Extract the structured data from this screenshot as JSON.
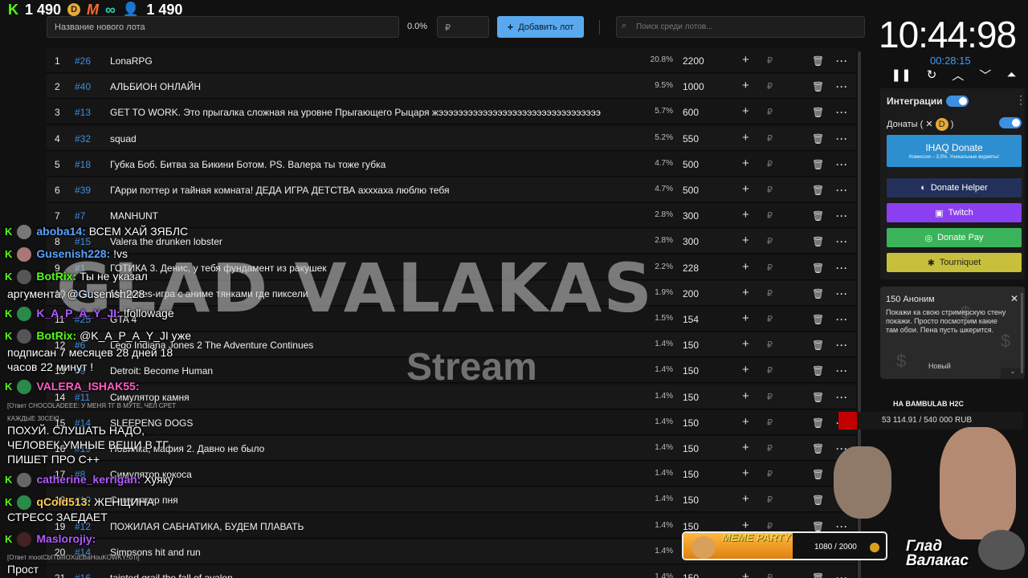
{
  "stats": {
    "kick_followers": "1 490",
    "viewers": "1 490"
  },
  "toolbar": {
    "lot_name_placeholder": "Название нового лота",
    "percent": "0.0%",
    "sum_placeholder": "₽",
    "add_label": "Добавить лот",
    "search_placeholder": "Поиск среди лотов..."
  },
  "lots": [
    {
      "num": "1",
      "id": "#26",
      "name": "LonaRPG",
      "pct": "20.8%",
      "sum": "2200"
    },
    {
      "num": "2",
      "id": "#40",
      "name": "АЛЬБИОН ОНЛАЙН",
      "pct": "9.5%",
      "sum": "1000"
    },
    {
      "num": "3",
      "id": "#13",
      "name": "GET TO WORK. Это прыгалка сложная на уровне Прыгающего Рыцаря жэээээээээээээээээээээээээээээээээ",
      "pct": "5.7%",
      "sum": "600"
    },
    {
      "num": "4",
      "id": "#32",
      "name": "squad",
      "pct": "5.2%",
      "sum": "550"
    },
    {
      "num": "5",
      "id": "#18",
      "name": "Губка Боб. Битва за Бикини Ботом. PS. Валера ты тоже губка",
      "pct": "4.7%",
      "sum": "500"
    },
    {
      "num": "6",
      "id": "#39",
      "name": "ГАрри поттер и тайная комната! ДЕДА ИГРА ДЕТСТВА ахххаха люблю тебя",
      "pct": "4.7%",
      "sum": "500"
    },
    {
      "num": "7",
      "id": "#7",
      "name": "MANHUNT",
      "pct": "2.8%",
      "sum": "300"
    },
    {
      "num": "8",
      "id": "#15",
      "name": "Valera the drunken lobster",
      "pct": "2.8%",
      "sum": "300"
    },
    {
      "num": "9",
      "id": "#1",
      "name": "ГОТИКА 3. Денис, у тебя фундамент из ракушек",
      "pct": "2.2%",
      "sum": "228"
    },
    {
      "num": "10",
      "id": "#30",
      "name": "Memories-игра с аниме тянками где пиксели",
      "pct": "1.9%",
      "sum": "200"
    },
    {
      "num": "11",
      "id": "#25",
      "name": "GTA 4",
      "pct": "1.5%",
      "sum": "154"
    },
    {
      "num": "12",
      "id": "#6",
      "name": "Lego Indiana Jones 2 The Adventure Continues",
      "pct": "1.4%",
      "sum": "150"
    },
    {
      "num": "13",
      "id": "#9",
      "name": "Detroit: Become Human",
      "pct": "1.4%",
      "sum": "150"
    },
    {
      "num": "14",
      "id": "#11",
      "name": "Симулятор камня",
      "pct": "1.4%",
      "sum": "150"
    },
    {
      "num": "15",
      "id": "#14",
      "name": "SLEEPENG DOGS",
      "pct": "1.4%",
      "sum": "150"
    },
    {
      "num": "16",
      "id": "#19",
      "name": "Новинка, мафия 2. Давно не было",
      "pct": "1.4%",
      "sum": "150"
    },
    {
      "num": "17",
      "id": "#8",
      "name": "Симулятор кокоса",
      "pct": "1.4%",
      "sum": "150"
    },
    {
      "num": "18",
      "id": "#10",
      "name": "Симулятор пня",
      "pct": "1.4%",
      "sum": "150"
    },
    {
      "num": "19",
      "id": "#12",
      "name": "ПОЖИЛАЯ САБНАТИКА, БУДЕМ ПЛАВАТЬ",
      "pct": "1.4%",
      "sum": "150"
    },
    {
      "num": "20",
      "id": "#14",
      "name": "Simpsons hit and run",
      "pct": "1.4%",
      "sum": ""
    },
    {
      "num": "21",
      "id": "#16",
      "name": "tainted grail the fall of avalon",
      "pct": "1.4%",
      "sum": "150"
    }
  ],
  "chat": [
    {
      "user": "aboba14:",
      "text": "ВСЕМ ХАЙ ЗЯБЛС",
      "color": "#5aa0ff"
    },
    {
      "user": "Gusenish228:",
      "text": "!vs",
      "color": "#5aa0ff"
    },
    {
      "user": "BotRix:",
      "text": "Ты не указал",
      "color": "#53fc18"
    },
    {
      "user": "",
      "text": "аргумента, @Gusenish228",
      "color": "#ffffff"
    },
    {
      "user": "K_A_P_A_Y_JI:",
      "text": "!followage",
      "color": "#b05aff"
    },
    {
      "user": "BotRix:",
      "text": "@K_A_P_A_Y_JI уже",
      "color": "#53fc18"
    },
    {
      "user": "",
      "text": "подписан 7 месяцев 28 дней 18",
      "color": "#ffffff"
    },
    {
      "user": "",
      "text": "часов 22 минут !",
      "color": "#ffffff"
    },
    {
      "user": "VALERA_ISHAK55:",
      "text": "",
      "color": "#ff5ac8"
    },
    {
      "user": "",
      "text": "ПОХУЙ. СЛУШАТЬ НАДО,",
      "color": "#ffffff"
    },
    {
      "user": "",
      "text": "ЧЕЛОВЕК УМНЫЕ ВЕЩИ В ТГ",
      "color": "#ffffff"
    },
    {
      "user": "",
      "text": "ПИШЕТ ПРО С++",
      "color": "#ffffff"
    },
    {
      "user": "catherine_kerrigan:",
      "text": "Хуяку",
      "color": "#b05aff"
    },
    {
      "user": "qCold513:",
      "text": "ЖЕНЩИНА",
      "color": "#ffd050"
    },
    {
      "user": "",
      "text": "СТРЕСС ЗАЕДАЕТ",
      "color": "#ffffff"
    },
    {
      "user": "Maslorojiy:",
      "text": "",
      "color": "#b05aff"
    },
    {
      "user": "",
      "text": "Прост",
      "color": "#ffffff"
    }
  ],
  "chat_notes": [
    "[Ответ CHOCOLADEEE: У МЕНЯ ТГ В МУТЕ, ЧЕЛ СРЕТ",
    "КАЖДЫЕ 30СЕК]",
    "[Ответ mootCbITbIIIOXuEBaHouKOWKY..oTi]"
  ],
  "watermark": {
    "title": "GLAD VALAKAS",
    "subtitle": "Stream"
  },
  "timer": {
    "clock": "10:44:98",
    "elapsed": "00:28:15"
  },
  "integrations": {
    "title": "Интеграции",
    "donates_label": "Донаты (",
    "donates_close": ")",
    "ihaq_title": "IHAQ Donate",
    "ihaq_sub": "Комиссия – 3,5%. Уникальные виджеты!",
    "donate_helper": "Donate Helper",
    "twitch": "Twitch",
    "donate_pay": "Donate Pay",
    "tourniquet": "Tourniquet"
  },
  "donation": {
    "who": "150 Аноним",
    "text": "Покажи ка свою стримерскую стену покажи. Просто посмотрим какие там обои. Пена пусть шкерится.",
    "status": "Новый"
  },
  "goal": {
    "title": "НА BAMBULAB H2C",
    "progress": "53 114.91 / 540 000 RUB",
    "fraction": 0.098
  },
  "meme": {
    "label": "MEME PARTY",
    "count": "1080 / 2000",
    "fraction": 0.54
  },
  "signature": {
    "line1": "Глад",
    "line2": "Валакас"
  },
  "colors": {
    "accent": "#3d8fe0",
    "kick": "#53fc18",
    "goal": "#c20000"
  }
}
